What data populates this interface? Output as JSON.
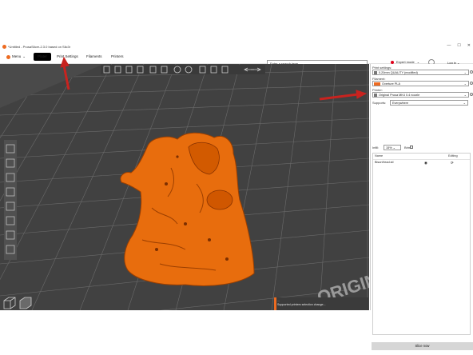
{
  "titlebar": {
    "title": "*Untitled - PrusaSlicer-2.3.0 based on Slic3r"
  },
  "menubar": {
    "menu_label": "Menu",
    "tabs": [
      "Plater",
      "Print Settings",
      "Filaments",
      "Printers"
    ],
    "search_placeholder": "Enter a search term",
    "mode_label": "Expert mode",
    "login_label": "Log in"
  },
  "right_panel": {
    "print_settings_label": "Print settings:",
    "print_profile": "0.20mm QUALITY (modified)",
    "filament_label": "Filament:",
    "filament_profile": "Overture PLA",
    "printer_label": "Printer:",
    "printer_profile": "Original Prusa MK4 0.4 nozzle",
    "supports_label": "Supports:",
    "supports_value": "Everywhere",
    "infill_label": "Infill:",
    "infill_value": "15%",
    "brim_label": "Brim:",
    "brim_checked": false,
    "objects_header_name": "Name",
    "objects_header_editing": "Editing",
    "objects": [
      {
        "name": "BisonHead.stl"
      }
    ],
    "slice_button": "Slice now"
  },
  "viewport": {
    "origin_text": "ORIGIN",
    "notice_line1": "...",
    "notice_line2": "Supported printers selection change..."
  },
  "colors": {
    "accent": "#ed6b21",
    "annotation_arrow": "#c8231f",
    "bed": "#4a4a4a",
    "expert_dot": "#e0001a"
  }
}
